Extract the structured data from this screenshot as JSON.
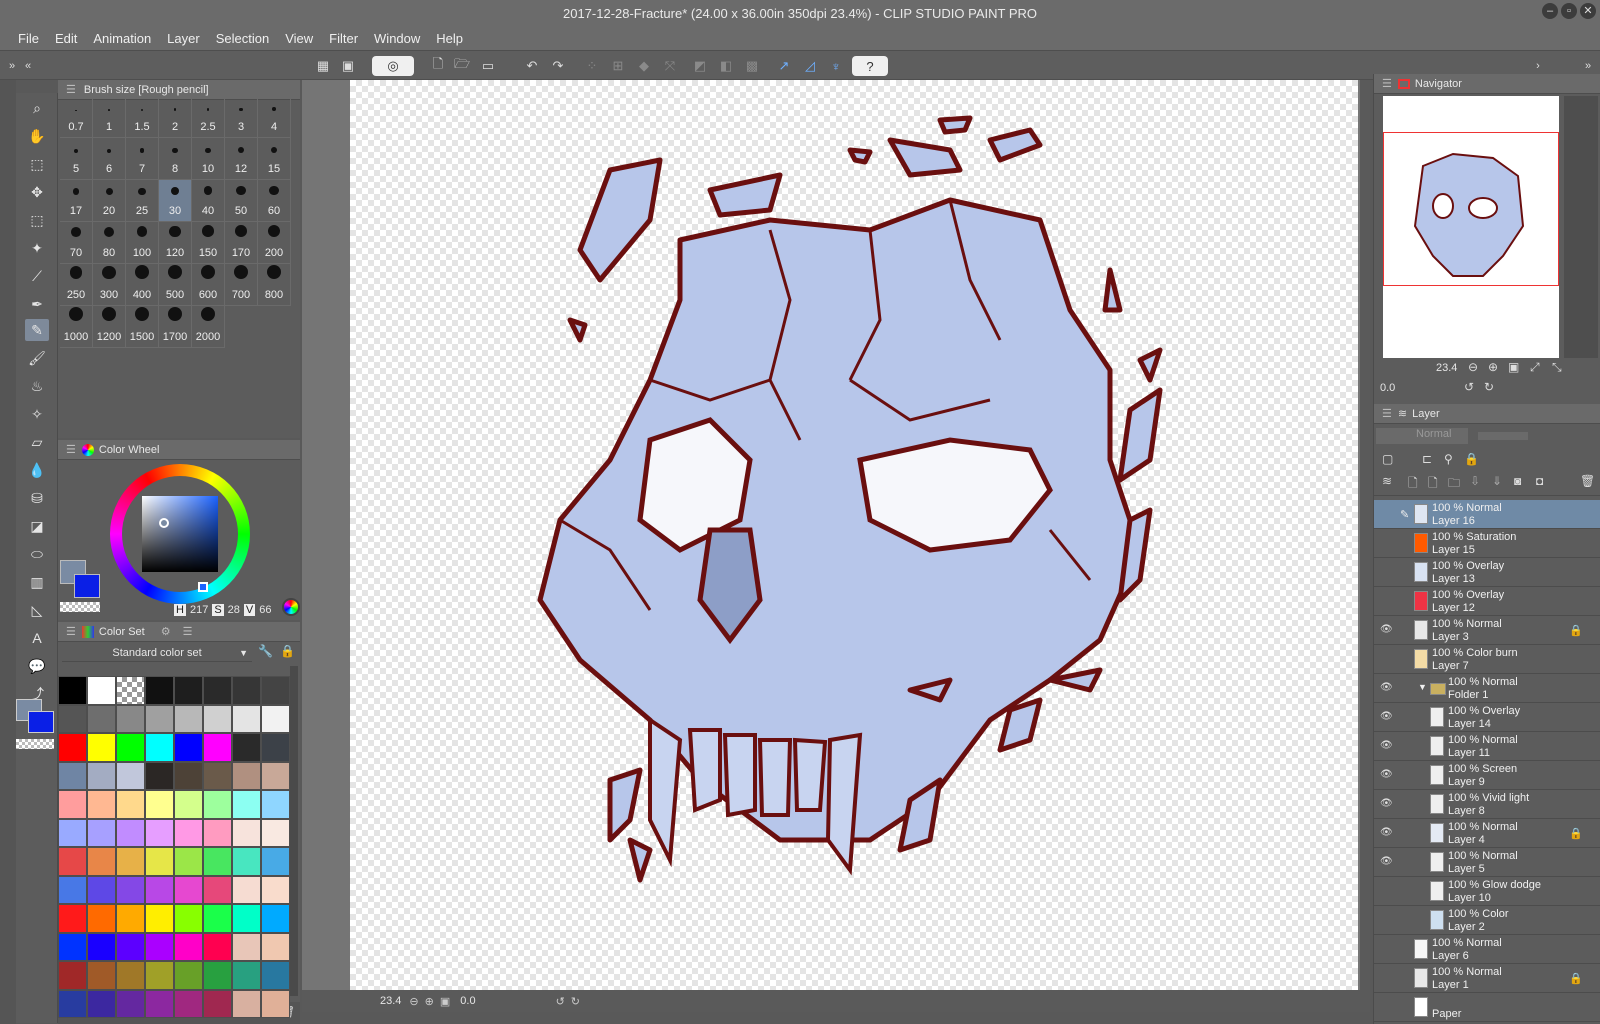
{
  "title": "2017-12-28-Fracture* (24.00 x 36.00in 350dpi 23.4%)  - CLIP STUDIO PAINT PRO",
  "menu": [
    "File",
    "Edit",
    "Animation",
    "Layer",
    "Selection",
    "View",
    "Filter",
    "Window",
    "Help"
  ],
  "brush_panel": {
    "title": "Brush size [Rough pencil]",
    "sizes": [
      "0.7",
      "1",
      "1.5",
      "2",
      "2.5",
      "3",
      "4",
      "5",
      "6",
      "7",
      "8",
      "10",
      "12",
      "15",
      "17",
      "20",
      "25",
      "30",
      "40",
      "50",
      "60",
      "70",
      "80",
      "100",
      "120",
      "150",
      "170",
      "200",
      "250",
      "300",
      "400",
      "500",
      "600",
      "700",
      "800",
      "1000",
      "1200",
      "1500",
      "1700",
      "2000"
    ],
    "selected": "30"
  },
  "color_wheel": {
    "title": "Color Wheel",
    "h_label": "H",
    "h_value": "217",
    "s_label": "S",
    "s_value": "28",
    "v_label": "V",
    "v_value": "66",
    "main_color": "#7a8ba3",
    "sub_color": "#0a1fe6"
  },
  "color_set": {
    "title": "Color Set",
    "set_name": "Standard color set",
    "colors": [
      "#000000",
      "#ffffff",
      "#cccccc",
      "#111111",
      "#1e1e1e",
      "#2a2a2a",
      "#363636",
      "#444444",
      "#555555",
      "#6e6e6e",
      "#888888",
      "#a0a0a0",
      "#b8b8b8",
      "#d0d0d0",
      "#e4e4e4",
      "#f2f2f2",
      "#ff0000",
      "#ffff00",
      "#00ff00",
      "#00ffff",
      "#0000ff",
      "#ff00ff",
      "#2a2a2a",
      "#3c4148",
      "#6f85a4",
      "#a3acc2",
      "#c1c7db",
      "#2b2725",
      "#4d4237",
      "#6a5a4a",
      "#b09080",
      "#c8a898",
      "#ff9d9d",
      "#ffb892",
      "#ffd98c",
      "#ffff8f",
      "#d4ff8c",
      "#9dff9d",
      "#8cfff2",
      "#8fd6ff",
      "#99aaff",
      "#a7a0ff",
      "#c18cff",
      "#e69eff",
      "#ff99e5",
      "#ff9bc0",
      "#f7e3dc",
      "#f9e9e1",
      "#e64848",
      "#e88648",
      "#e7b148",
      "#e6e648",
      "#9be648",
      "#48e660",
      "#48e6c0",
      "#48aae6",
      "#4878e6",
      "#5e48e6",
      "#8448e6",
      "#b848e6",
      "#e648d0",
      "#e6487a",
      "#f6dcd2",
      "#f9dccc",
      "#ff1a1a",
      "#ff6a00",
      "#ffaa00",
      "#ffee00",
      "#88ff00",
      "#1aff4a",
      "#00ffc8",
      "#00aaff",
      "#0033ff",
      "#1a00ff",
      "#5c00ff",
      "#aa00ff",
      "#ff00c8",
      "#ff0050",
      "#e8c6b8",
      "#f0c8b0",
      "#a02828",
      "#a05a28",
      "#a07828",
      "#a0a028",
      "#68a028",
      "#28a040",
      "#28a080",
      "#2878a0",
      "#283ca0",
      "#3c28a0",
      "#6428a0",
      "#8c28a0",
      "#a02880",
      "#a02850",
      "#d8b0a0",
      "#e0b098"
    ],
    "bottom_colors": [
      "#cc0000",
      "#00aa00",
      "#0000cc"
    ]
  },
  "navigator": {
    "title": "Navigator",
    "zoom": "23.4",
    "rotation": "0.0"
  },
  "layer_panel": {
    "title": "Layer",
    "blend_mode": "Normal",
    "layers": [
      {
        "line1": "100 % Normal",
        "line2": "Layer 16",
        "indent": 0,
        "visible": false,
        "selected": true,
        "locked": false,
        "thumb": "#dfe6f2"
      },
      {
        "line1": "100 % Saturation",
        "line2": "Layer 15",
        "indent": 0,
        "visible": false,
        "selected": false,
        "locked": false,
        "thumb": "#ff5a00"
      },
      {
        "line1": "100 % Overlay",
        "line2": "Layer 13",
        "indent": 0,
        "visible": false,
        "selected": false,
        "locked": false,
        "thumb": "#d8e2f2"
      },
      {
        "line1": "100 % Overlay",
        "line2": "Layer 12",
        "indent": 0,
        "visible": false,
        "selected": false,
        "locked": false,
        "thumb": "#ee3344"
      },
      {
        "line1": "100 % Normal",
        "line2": "Layer 3",
        "indent": 0,
        "visible": true,
        "selected": false,
        "locked": true,
        "thumb": "#e8e8e8"
      },
      {
        "line1": "100 % Color burn",
        "line2": "Layer 7",
        "indent": 0,
        "visible": false,
        "selected": false,
        "locked": false,
        "thumb": "#f4dca6"
      },
      {
        "line1": "100 % Normal",
        "line2": "Folder 1",
        "indent": 1,
        "visible": true,
        "selected": false,
        "locked": false,
        "thumb": "folder"
      },
      {
        "line1": "100 % Overlay",
        "line2": "Layer 14",
        "indent": 2,
        "visible": true,
        "selected": false,
        "locked": false,
        "thumb": "#efefef"
      },
      {
        "line1": "100 % Normal",
        "line2": "Layer 11",
        "indent": 2,
        "visible": true,
        "selected": false,
        "locked": false,
        "thumb": "#efefef"
      },
      {
        "line1": "100 % Screen",
        "line2": "Layer 9",
        "indent": 2,
        "visible": true,
        "selected": false,
        "locked": false,
        "thumb": "#efefef"
      },
      {
        "line1": "100 % Vivid light",
        "line2": "Layer 8",
        "indent": 2,
        "visible": true,
        "selected": false,
        "locked": false,
        "thumb": "#efefef"
      },
      {
        "line1": "100 % Normal",
        "line2": "Layer 4",
        "indent": 2,
        "visible": true,
        "selected": false,
        "locked": true,
        "thumb": "#e4eaf4"
      },
      {
        "line1": "100 % Normal",
        "line2": "Layer 5",
        "indent": 2,
        "visible": true,
        "selected": false,
        "locked": false,
        "thumb": "#efefef"
      },
      {
        "line1": "100 % Glow dodge",
        "line2": "Layer 10",
        "indent": 2,
        "visible": false,
        "selected": false,
        "locked": false,
        "thumb": "#efefef"
      },
      {
        "line1": "100 % Color",
        "line2": "Layer 2",
        "indent": 2,
        "visible": false,
        "selected": false,
        "locked": false,
        "thumb": "#cfe0f0"
      },
      {
        "line1": "100 % Normal",
        "line2": "Layer 6",
        "indent": 0,
        "visible": false,
        "selected": false,
        "locked": false,
        "thumb": "#f7f7f7"
      },
      {
        "line1": "100 % Normal",
        "line2": "Layer 1",
        "indent": 0,
        "visible": false,
        "selected": false,
        "locked": true,
        "thumb": "#e8e8e8"
      },
      {
        "line1": "",
        "line2": "Paper",
        "indent": 0,
        "visible": false,
        "selected": false,
        "locked": false,
        "thumb": "#ffffff"
      }
    ]
  },
  "status": {
    "zoom": "23.4",
    "rotation": "0.0"
  },
  "icons": {
    "zoom": "magnifier-icon",
    "hand": "hand-icon",
    "pen": "pen-icon",
    "eraser": "eraser-icon",
    "text": "text-icon",
    "help": "question-icon"
  }
}
